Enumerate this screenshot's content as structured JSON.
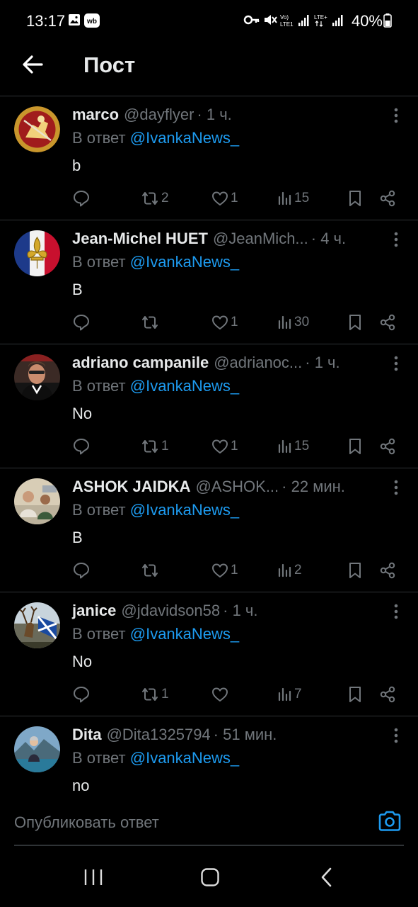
{
  "status_bar": {
    "time": "13:17",
    "network_label": "LTE1",
    "battery": "40%"
  },
  "header": {
    "title": "Пост"
  },
  "replies": [
    {
      "name": "marco",
      "handle": "@dayflyer",
      "time": "· 1 ч.",
      "reply_to_prefix": "В ответ",
      "reply_to": "@IvankaNews_",
      "text": "b",
      "retweets": "2",
      "likes": "1",
      "views": "15",
      "avatar": "st-george-icon"
    },
    {
      "name": "Jean-Michel HUET",
      "handle": "@JeanMich...",
      "time": "· 4 ч.",
      "reply_to_prefix": "В ответ",
      "reply_to": "@IvankaNews_",
      "text": "B",
      "retweets": "",
      "likes": "1",
      "views": "30",
      "avatar": "fleur-de-lis-icon"
    },
    {
      "name": "adriano campanile",
      "handle": "@adrianoc...",
      "time": "· 1 ч.",
      "reply_to_prefix": "В ответ",
      "reply_to": "@IvankaNews_",
      "text": "No",
      "retweets": "1",
      "likes": "1",
      "views": "15",
      "avatar": "person-photo"
    },
    {
      "name": "ASHOK JAIDKA",
      "handle": "@ASHOK...",
      "time": "· 22 мин.",
      "reply_to_prefix": "В ответ",
      "reply_to": "@IvankaNews_",
      "text": "B",
      "retweets": "",
      "likes": "1",
      "views": "2",
      "avatar": "group-photo"
    },
    {
      "name": "janice",
      "handle": "@jdavidson58",
      "time": "· 1 ч.",
      "reply_to_prefix": "В ответ",
      "reply_to": "@IvankaNews_",
      "text": "No",
      "retweets": "1",
      "likes": "",
      "views": "7",
      "avatar": "stag-flag-photo"
    },
    {
      "name": "Dita",
      "handle": "@Dita1325794",
      "time": "· 51 мин.",
      "reply_to_prefix": "В ответ",
      "reply_to": "@IvankaNews_",
      "text": "no",
      "retweets": "",
      "likes": "",
      "views": "",
      "avatar": "landscape-photo"
    }
  ],
  "compose": {
    "placeholder": "Опубликовать ответ"
  },
  "colors": {
    "accent": "#1d9bf0",
    "muted": "#71767b",
    "divider": "#2f3336"
  }
}
